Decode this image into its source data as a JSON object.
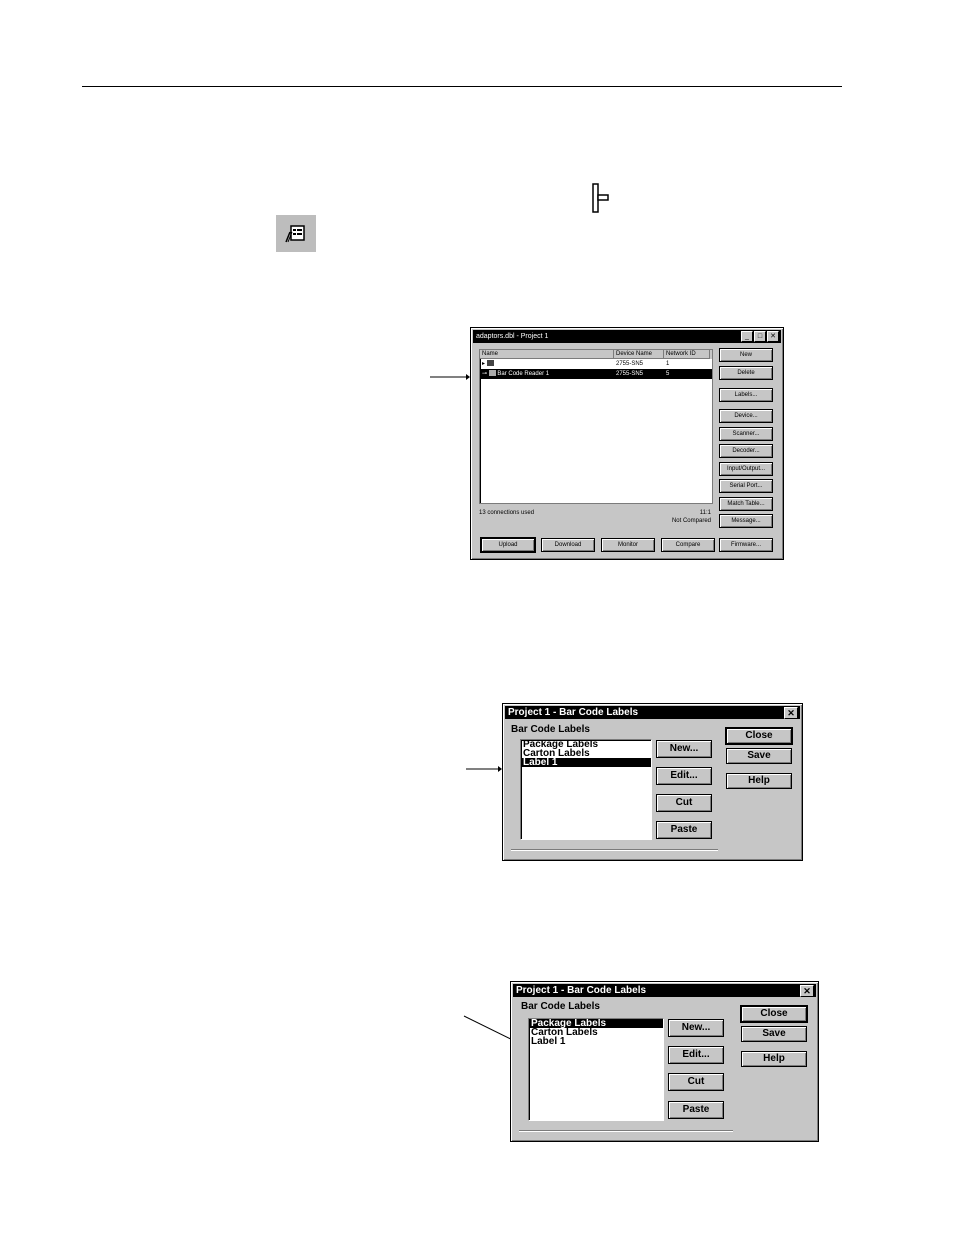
{
  "window1": {
    "title": "adaptors.dbl - Project 1",
    "columns": [
      "Name",
      "Device Name",
      "Network ID"
    ],
    "rows": [
      {
        "name": "",
        "device": "2755-SN5",
        "network_id": "1",
        "selected": false
      },
      {
        "name": "Bar Code Reader 1",
        "device": "2755-SN5",
        "network_id": "5",
        "selected": true
      }
    ],
    "status_left": "13 connections used",
    "status_right_top": "11:1",
    "status_right_bottom": "Not Compared",
    "side_buttons": [
      "New",
      "Delete",
      "Labels...",
      "Device...",
      "Scanner...",
      "Decoder...",
      "Input/Output...",
      "Serial Port...",
      "Match Table...",
      "Message..."
    ],
    "bottom_buttons": [
      "Upload",
      "Download",
      "Monitor",
      "Compare",
      "Firmware..."
    ]
  },
  "window2": {
    "title": "Project 1 - Bar Code Labels",
    "group_label": "Bar Code Labels",
    "items": [
      "Package Labels",
      "Carton Labels",
      "Label 1"
    ],
    "selected_index": 2,
    "mid_buttons": [
      "New...",
      "Edit...",
      "Cut",
      "Paste"
    ],
    "right_buttons": [
      "Close",
      "Save",
      "Help"
    ]
  },
  "window3": {
    "title": "Project 1 - Bar Code Labels",
    "group_label": "Bar Code Labels",
    "items": [
      "Package Labels",
      "Carton Labels",
      "Label 1"
    ],
    "selected_index": 0,
    "mid_buttons": [
      "New...",
      "Edit...",
      "Cut",
      "Paste"
    ],
    "right_buttons": [
      "Close",
      "Save",
      "Help"
    ]
  }
}
